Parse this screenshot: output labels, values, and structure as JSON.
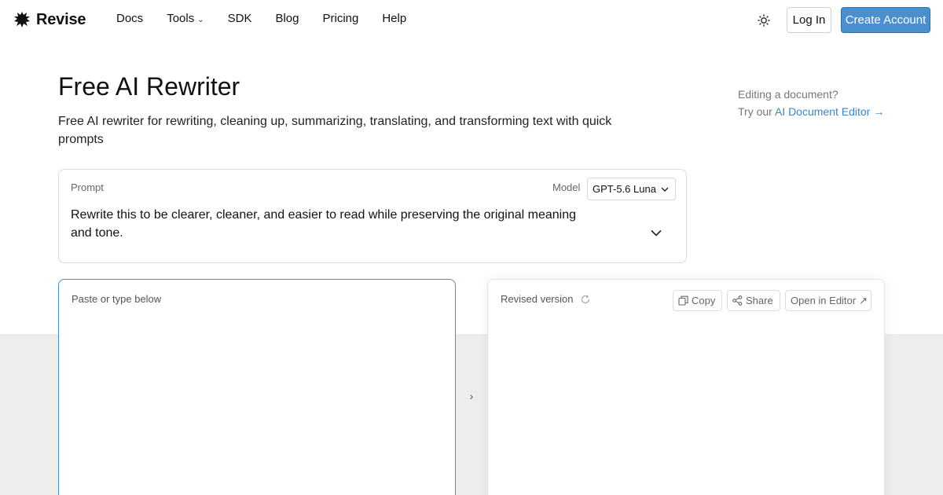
{
  "header": {
    "logo_text": "Revise",
    "nav": [
      {
        "label": "Docs",
        "has_dropdown": false
      },
      {
        "label": "Tools",
        "has_dropdown": true
      },
      {
        "label": "SDK",
        "has_dropdown": false
      },
      {
        "label": "Blog",
        "has_dropdown": false
      },
      {
        "label": "Pricing",
        "has_dropdown": false
      },
      {
        "label": "Help",
        "has_dropdown": false
      }
    ],
    "theme_icon": "sun-icon",
    "login_label": "Log In",
    "create_account_label": "Create Account"
  },
  "hero": {
    "title": "Free AI Rewriter",
    "subtitle": "Free AI rewriter for rewriting, cleaning up, summarizing, translating, and transforming text with quick prompts"
  },
  "side_note": {
    "line1": "Editing a document?",
    "prefix": "Try our",
    "link_label": "AI Document Editor",
    "arrow": "→"
  },
  "prompt": {
    "label": "Prompt",
    "model_label": "Model",
    "model_value": "GPT-5.6 Luna",
    "text": "Rewrite this to be clearer, cleaner, and easier to read while preserving the original meaning and tone."
  },
  "input_panel": {
    "placeholder": "Paste or type below"
  },
  "output_panel": {
    "label": "Revised version",
    "copy_label": "Copy",
    "share_label": "Share",
    "open_label": "Open in Editor",
    "open_arrow": "↗"
  },
  "swap_arrow": "›",
  "colors": {
    "accent": "#4a8fd0",
    "link": "#3b86c6",
    "band": "#efedeb"
  }
}
